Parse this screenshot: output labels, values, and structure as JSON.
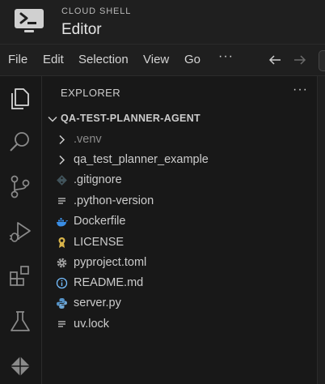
{
  "header": {
    "brand_sub": "CLOUD SHELL",
    "title": "Editor"
  },
  "menubar": {
    "items": [
      "File",
      "Edit",
      "Selection",
      "View",
      "Go"
    ],
    "more": "···"
  },
  "activity_bar": {
    "icons": [
      "explorer-icon",
      "search-icon",
      "source-control-icon",
      "run-debug-icon",
      "extensions-icon",
      "testing-icon",
      "cloud-code-icon"
    ]
  },
  "explorer": {
    "title": "EXPLORER",
    "more": "···",
    "folder": "QA-TEST-PLANNER-AGENT",
    "items": [
      {
        "label": ".venv",
        "icon": "chevron-right-icon",
        "dim": true
      },
      {
        "label": "qa_test_planner_example",
        "icon": "chevron-right-icon",
        "dim": false
      },
      {
        "label": ".gitignore",
        "icon": "git-icon",
        "dim": false
      },
      {
        "label": ".python-version",
        "icon": "lines-icon",
        "dim": false
      },
      {
        "label": "Dockerfile",
        "icon": "docker-icon",
        "dim": false
      },
      {
        "label": "LICENSE",
        "icon": "license-icon",
        "dim": false
      },
      {
        "label": "pyproject.toml",
        "icon": "gear-icon",
        "dim": false
      },
      {
        "label": "README.md",
        "icon": "info-icon",
        "dim": false
      },
      {
        "label": "server.py",
        "icon": "python-icon",
        "dim": false
      },
      {
        "label": "uv.lock",
        "icon": "lines-icon",
        "dim": false
      }
    ]
  },
  "colors": {
    "background": "#1f1f1f",
    "sidebar": "#181818",
    "text": "#cccccc",
    "docker": "#3a8ee6",
    "python": "#5593c8",
    "info": "#75beff",
    "license": "#d9b44a"
  }
}
